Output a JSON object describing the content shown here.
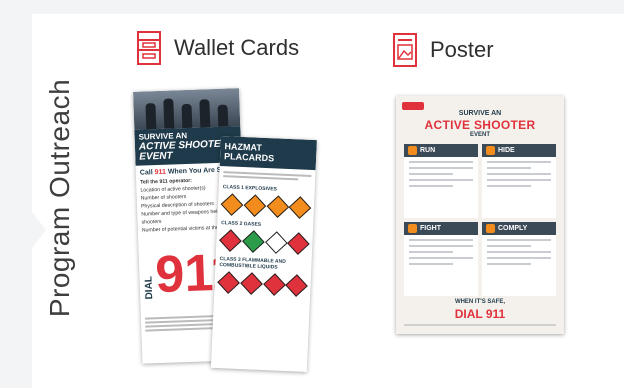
{
  "section": {
    "title": "Program Outreach"
  },
  "items": [
    {
      "label": "Wallet Cards",
      "icon": "wallet-card-icon",
      "accent": "#e0323c"
    },
    {
      "label": "Poster",
      "icon": "poster-icon",
      "accent": "#e0323c"
    }
  ],
  "wallet_card_front": {
    "headline_top": "SURVIVE AN",
    "headline_main": "ACTIVE SHOOTER EVENT",
    "call_prefix": "Call",
    "call_number": "911",
    "call_suffix": "When You Are Safe",
    "subheading": "Tell the 911 operator:",
    "list": [
      "Location of active shooter(s)",
      "Number of shooters",
      "Physical description of shooters",
      "Number and type of weapons held by shooters",
      "Number of potential victims at the location"
    ],
    "dial_word": "DIAL",
    "dial_number": "911"
  },
  "wallet_card_back": {
    "title": "HAZMAT PLACARDS",
    "class1": "CLASS 1 EXPLOSIVES",
    "class2": "CLASS 2 GASES",
    "class3": "CLASS 3 FLAMMABLE AND COMBUSTIBLE LIQUIDS"
  },
  "poster": {
    "title_top": "SURVIVE AN",
    "title_main": "ACTIVE SHOOTER",
    "title_bottom": "EVENT",
    "boxes": [
      "RUN",
      "HIDE",
      "FIGHT",
      "COMPLY"
    ],
    "footer_top": "WHEN IT'S SAFE,",
    "footer_main": "DIAL 911"
  }
}
